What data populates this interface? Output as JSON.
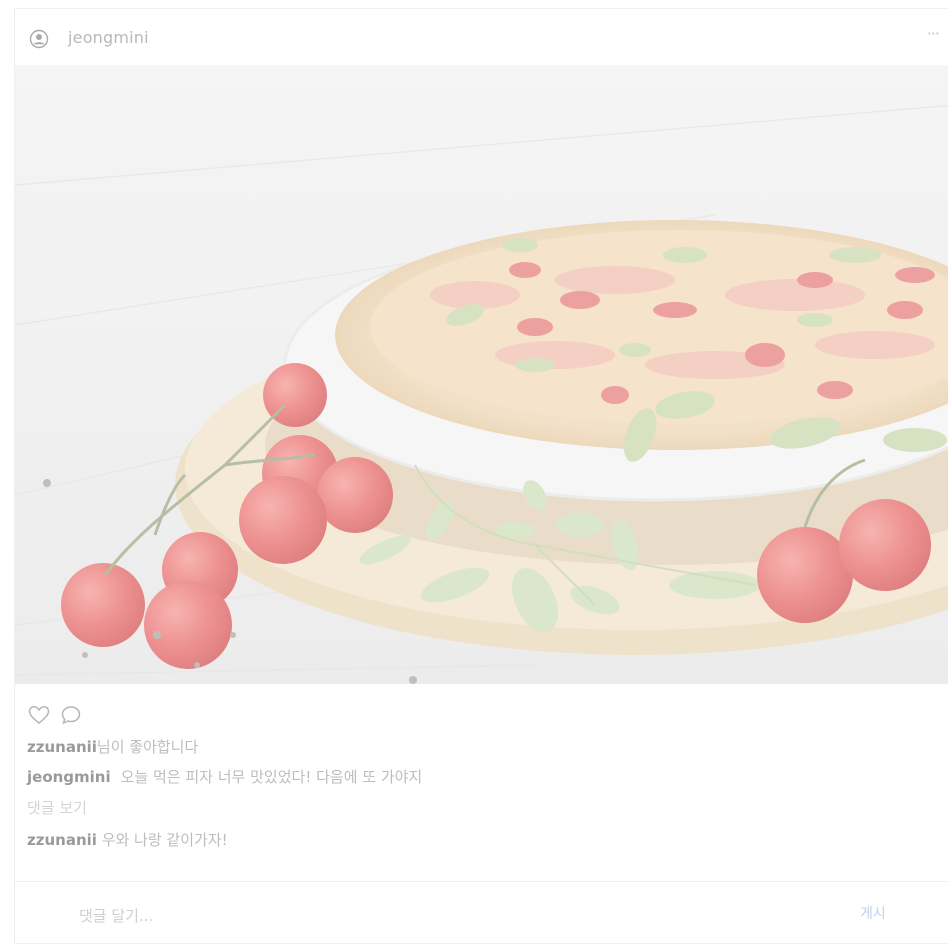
{
  "post": {
    "author": "jeongmini",
    "more_label": "···",
    "image_alt": "pizza",
    "likes": {
      "user": "zzunanii",
      "suffix": "님이 좋아합니다"
    },
    "caption": {
      "user": "jeongmini",
      "text": "오늘 먹은 피자 너무 맛있었다! 다음에 또 가야지"
    },
    "view_comments": "댓글 보기",
    "comments": [
      {
        "user": "zzunanii",
        "text": "우와 나랑 같이가자!"
      }
    ],
    "comment_input": {
      "placeholder": "댓글 달기...",
      "value": ""
    },
    "post_label": "게시"
  },
  "icons": {
    "avatar": "user-circle-icon",
    "like": "heart-icon",
    "comment": "speech-bubble-icon",
    "more": "ellipsis-icon"
  },
  "colors": {
    "text_muted": "#bdbdbd",
    "username": "#9a9a9a",
    "post_button": "#bcd3ee",
    "border": "#efefef"
  }
}
